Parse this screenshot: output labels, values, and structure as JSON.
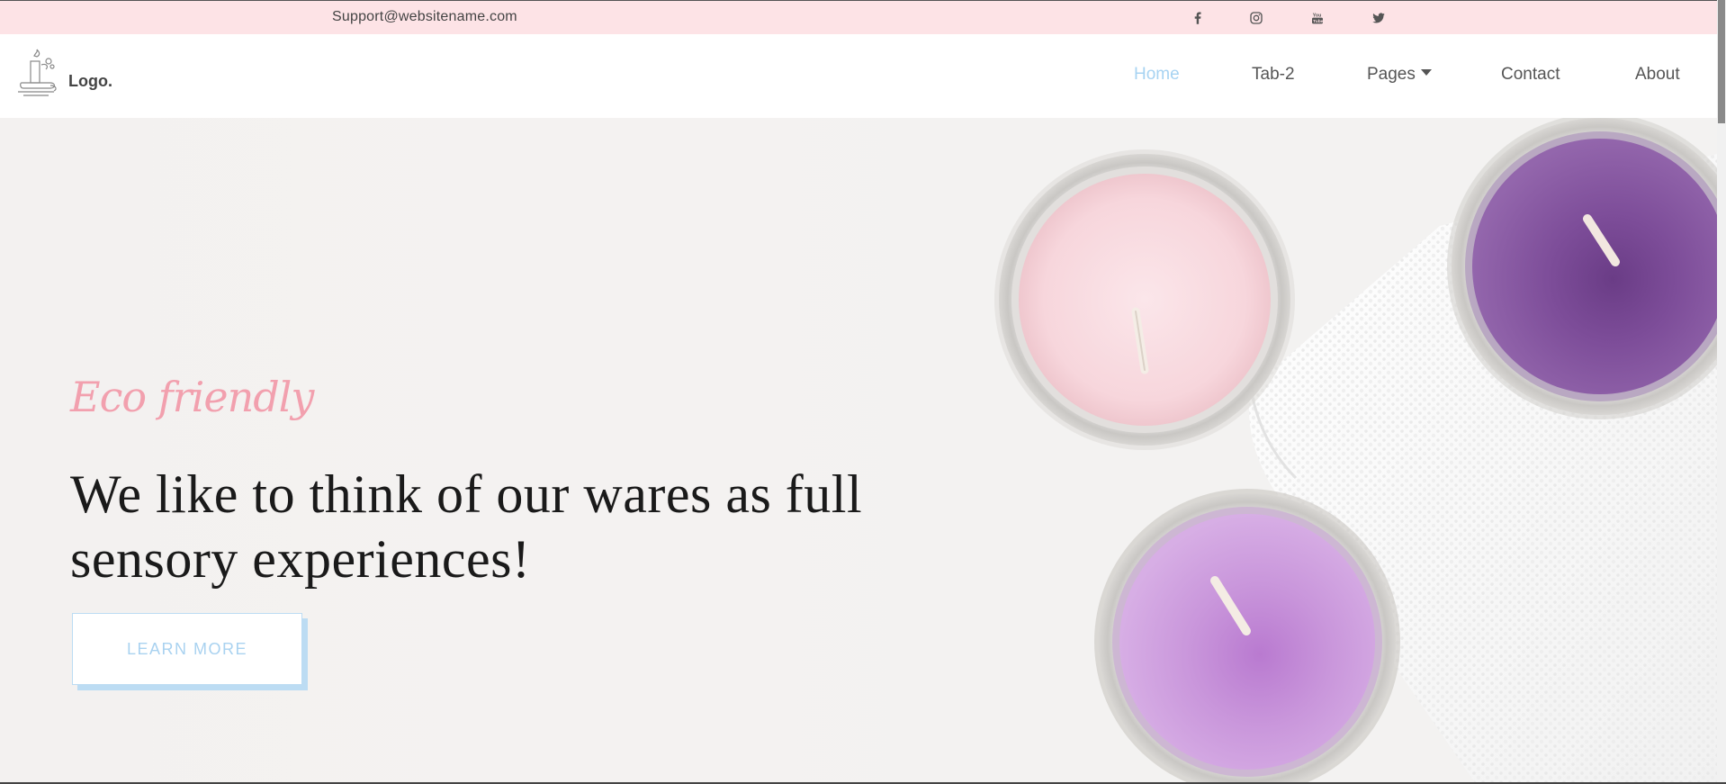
{
  "topbar": {
    "email": "Support@websitename.com",
    "social": [
      {
        "icon": "facebook-icon"
      },
      {
        "icon": "instagram-icon"
      },
      {
        "icon": "youtube-icon"
      },
      {
        "icon": "twitter-icon"
      }
    ]
  },
  "header": {
    "logo_text": "Logo.",
    "nav": [
      {
        "label": "Home",
        "active": true
      },
      {
        "label": "Tab-2"
      },
      {
        "label": "Pages"
      },
      {
        "label": "Contact"
      },
      {
        "label": "About"
      }
    ]
  },
  "hero": {
    "tagline": "Eco friendly",
    "headline": "We like to think of our wares as full sensory experiences!",
    "button_label": "LEARN MORE"
  },
  "colors": {
    "topbar_bg": "#fde3e6",
    "accent_blue": "#a7d3f2",
    "accent_pink": "#f2a0ae"
  }
}
